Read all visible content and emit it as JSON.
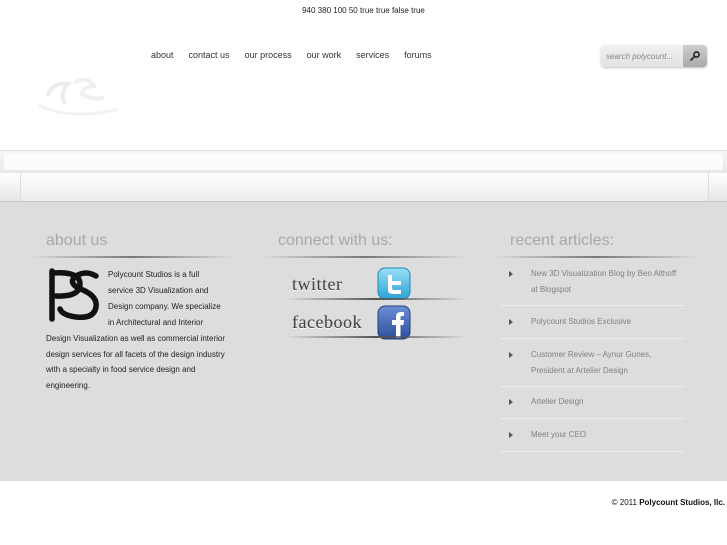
{
  "nav": {
    "items": [
      {
        "label": "about"
      },
      {
        "label": "contact us"
      },
      {
        "label": "our process"
      },
      {
        "label": "our work"
      },
      {
        "label": "services"
      },
      {
        "label": "forums"
      }
    ]
  },
  "search": {
    "placeholder": "search polycount...",
    "button_icon": "search-icon"
  },
  "strip": {
    "text": "940 380 100 50 true true false true"
  },
  "about": {
    "title": "about us",
    "logo_text": "PS",
    "body": "Polycount Studios is a full service 3D Visualization and Design company. We specialize in Architectural and Interior Design Visualization as well as commercial interior design services for all facets of the design industry with a specialty in food service design and engineering."
  },
  "connect": {
    "title": "connect with us:",
    "twitter": {
      "label": "twitter",
      "icon": "twitter-icon",
      "icon_color": "#4fb8e8"
    },
    "facebook": {
      "label": "facebook",
      "icon": "facebook-icon",
      "icon_color": "#3b5998"
    }
  },
  "recent": {
    "title": "recent articles:",
    "articles": [
      {
        "title": "New 3D Visualization Blog by Ben Althoff at Blogspot"
      },
      {
        "title": "Polycount Studios Exclusive"
      },
      {
        "title": "Customer Review – Aynur Gunes, President at Artelier Design"
      },
      {
        "title": "Artelier Design"
      },
      {
        "title": "Meet your CEO"
      }
    ]
  },
  "footer": {
    "year": "© 2011",
    "company": "Polycount Studios, llc."
  }
}
